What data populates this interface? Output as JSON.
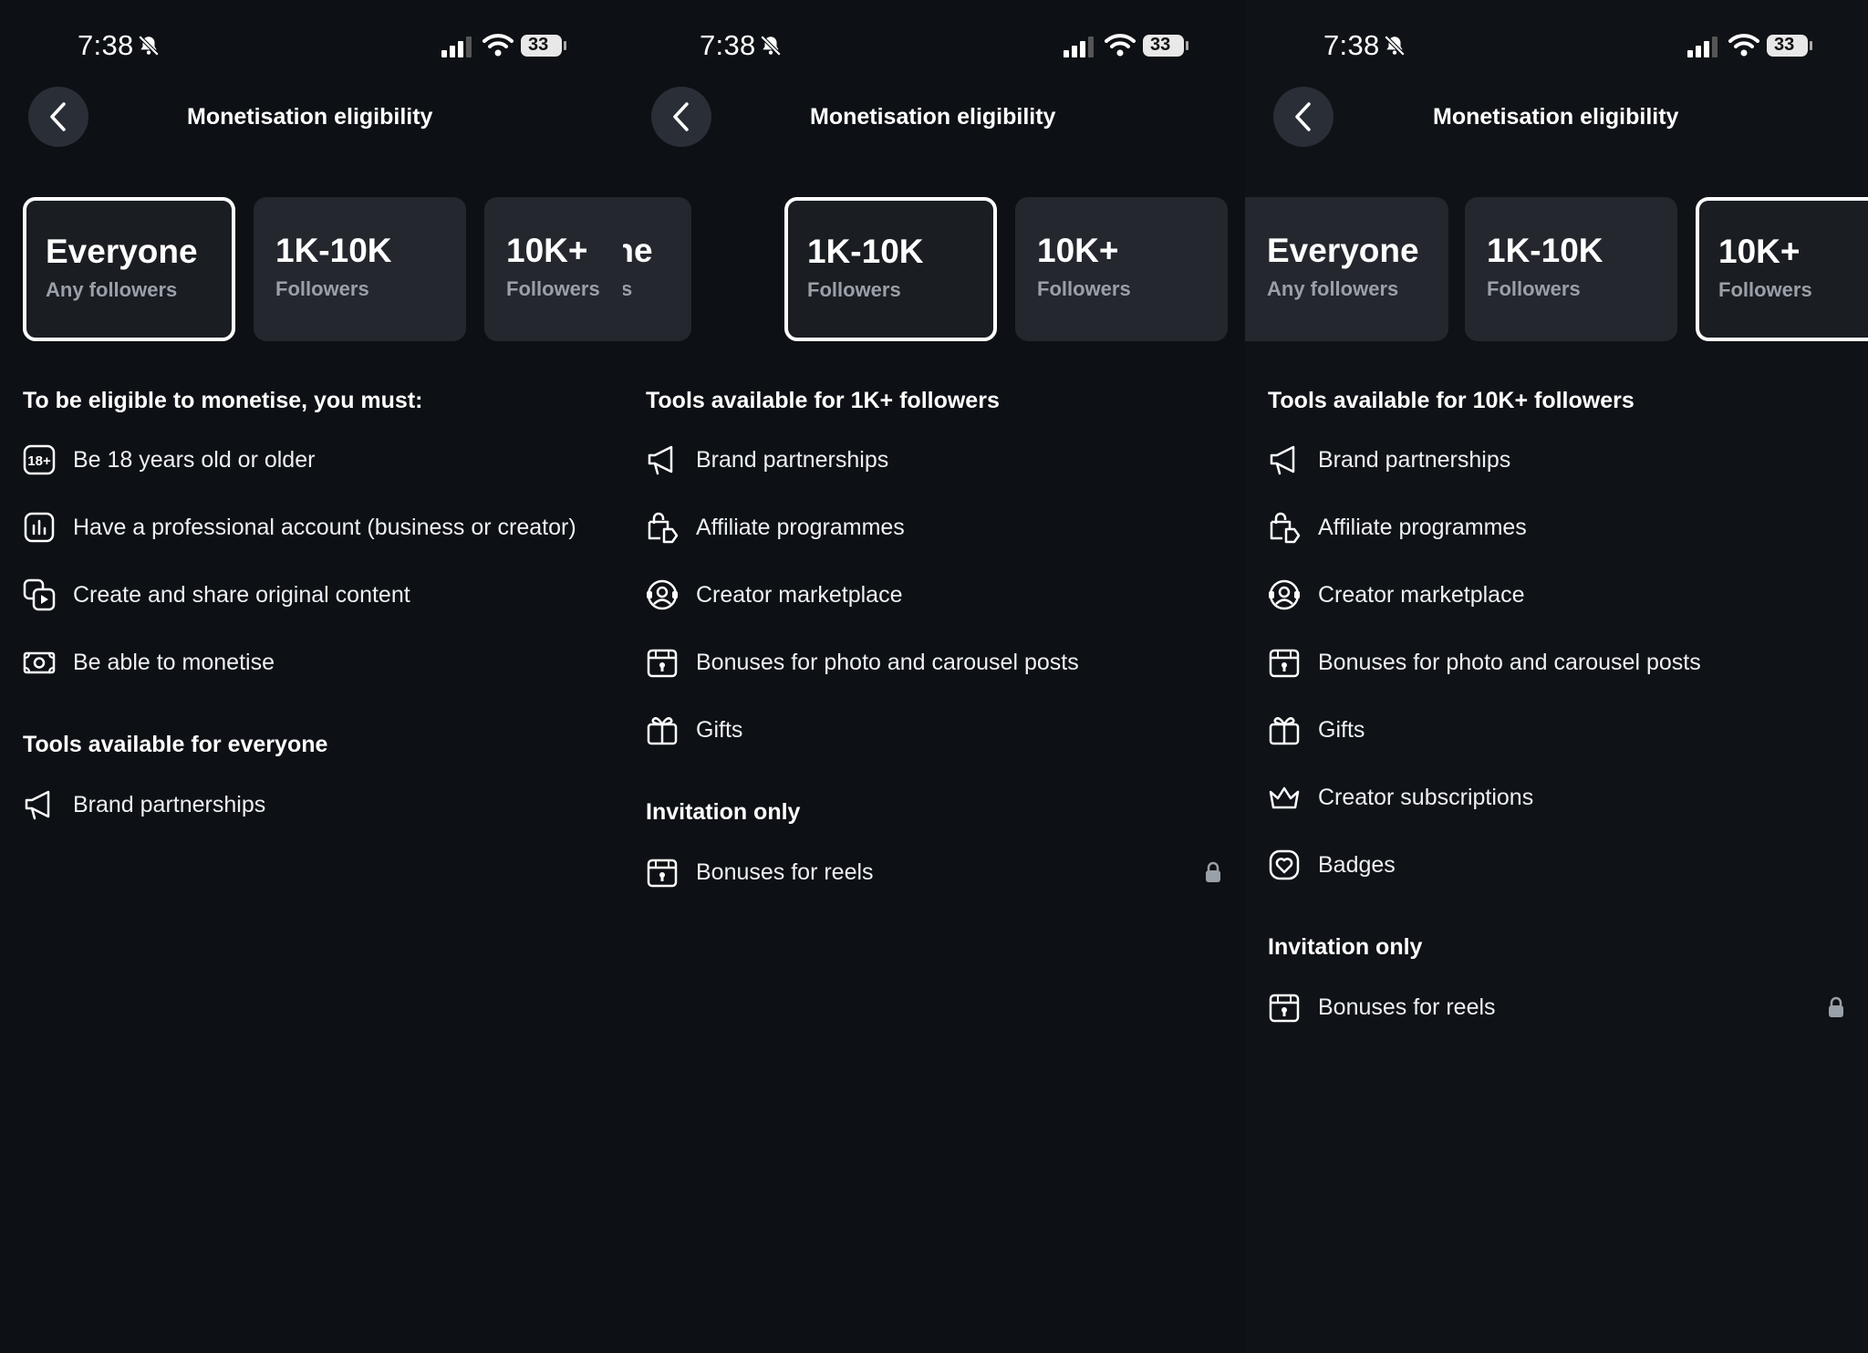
{
  "status": {
    "time": "7:38",
    "battery": "33"
  },
  "header": {
    "title": "Monetisation eligibility"
  },
  "cards": [
    {
      "big": "Everyone",
      "small": "Any followers"
    },
    {
      "big": "1K-10K",
      "small": "Followers"
    },
    {
      "big": "10K+",
      "small": "Followers"
    }
  ],
  "panel1": {
    "requirements_title": "To be eligible to monetise, you must:",
    "requirements": [
      {
        "icon": "age-18-icon",
        "label": "Be 18 years old or older"
      },
      {
        "icon": "professional-account-icon",
        "label": "Have a professional account (business or creator)"
      },
      {
        "icon": "original-content-icon",
        "label": "Create and share original content"
      },
      {
        "icon": "money-icon",
        "label": "Be able to monetise"
      }
    ],
    "tools_title": "Tools available for everyone",
    "tools": [
      {
        "icon": "megaphone-icon",
        "label": "Brand partnerships"
      }
    ]
  },
  "panel2": {
    "tools_title": "Tools available for 1K+ followers",
    "tools": [
      {
        "icon": "megaphone-icon",
        "label": "Brand partnerships"
      },
      {
        "icon": "affiliate-tag-icon",
        "label": "Affiliate programmes"
      },
      {
        "icon": "creator-marketplace-icon",
        "label": "Creator marketplace"
      },
      {
        "icon": "bonus-gift-box-icon",
        "label": "Bonuses for photo and carousel posts"
      },
      {
        "icon": "gift-icon",
        "label": "Gifts"
      }
    ],
    "invitation_title": "Invitation only",
    "invitation": [
      {
        "icon": "bonus-gift-box-icon",
        "label": "Bonuses for reels",
        "locked": true
      }
    ]
  },
  "panel3": {
    "tools_title": "Tools available for 10K+ followers",
    "tools": [
      {
        "icon": "megaphone-icon",
        "label": "Brand partnerships"
      },
      {
        "icon": "affiliate-tag-icon",
        "label": "Affiliate programmes"
      },
      {
        "icon": "creator-marketplace-icon",
        "label": "Creator marketplace"
      },
      {
        "icon": "bonus-gift-box-icon",
        "label": "Bonuses for photo and carousel posts"
      },
      {
        "icon": "gift-icon",
        "label": "Gifts"
      },
      {
        "icon": "crown-icon",
        "label": "Creator subscriptions"
      },
      {
        "icon": "badge-heart-icon",
        "label": "Badges"
      }
    ],
    "invitation_title": "Invitation only",
    "invitation": [
      {
        "icon": "bonus-gift-box-icon",
        "label": "Bonuses for reels",
        "locked": true
      }
    ]
  },
  "colors": {
    "background": "#0d1014",
    "card": "#24272d",
    "selected_border": "#ffffff",
    "muted_text": "#9aa0a8"
  }
}
